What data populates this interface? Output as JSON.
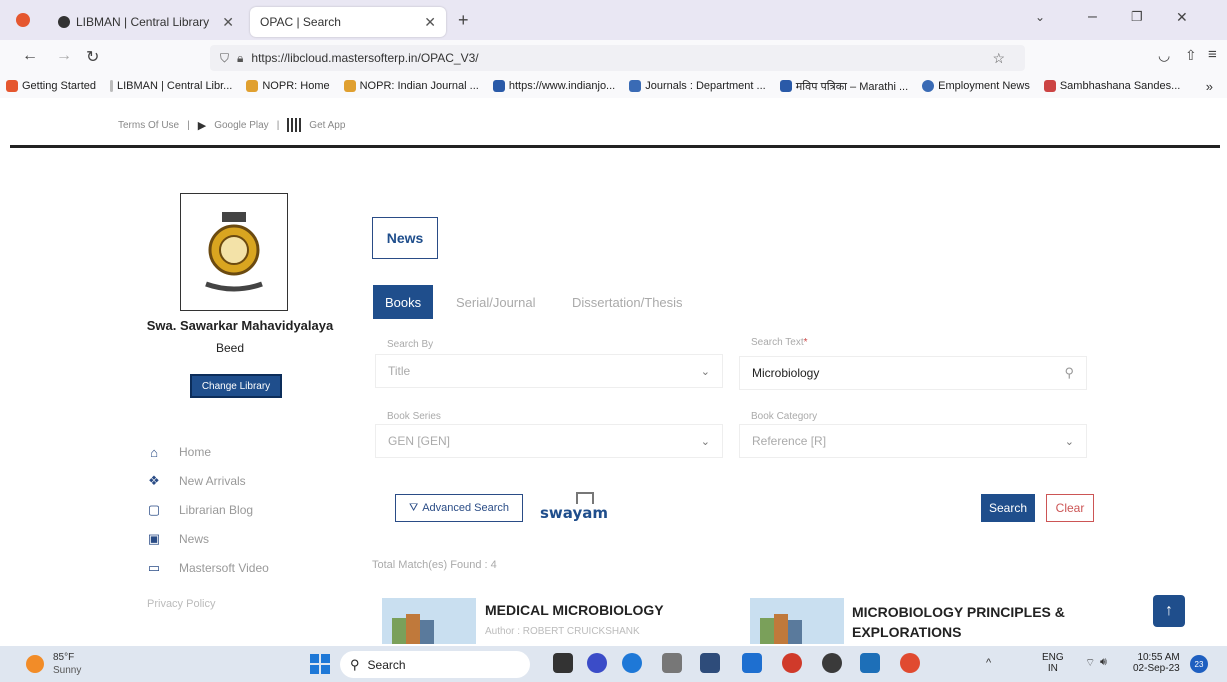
{
  "browser": {
    "tabs": [
      {
        "label": "LIBMAN | Central Library"
      },
      {
        "label": "OPAC | Search"
      }
    ],
    "new_tab": "+",
    "url": "https://libcloud.mastersofterp.in/OPAC_V3/",
    "bookmarks": [
      {
        "label": "Getting Started",
        "color": "#e5572f"
      },
      {
        "label": "LIBMAN | Central Libr...",
        "color": "#bbbbbb"
      },
      {
        "label": "NOPR: Home",
        "color": "#e0a030"
      },
      {
        "label": "NOPR: Indian Journal ...",
        "color": "#e0a030"
      },
      {
        "label": "https://www.indianjo...",
        "color": "#2a5aa8"
      },
      {
        "label": "Journals : Department ...",
        "color": "#3a6bb5"
      },
      {
        "label": "मविप पत्रिका – Marathi ...",
        "color": "#2a5aa8"
      },
      {
        "label": "Employment News",
        "color": "#3a6bb5"
      },
      {
        "label": "Sambhashana Sandes...",
        "color": "#c44"
      }
    ]
  },
  "toplinks": {
    "terms": "Terms Of Use",
    "google_play": "Google Play",
    "get_app": "Get App"
  },
  "library": {
    "college": "Swa. Sawarkar Mahavidyalaya",
    "city": "Beed",
    "change_button": "Change Library"
  },
  "sidebar": [
    {
      "label": "Home",
      "icon": "home-icon"
    },
    {
      "label": "New Arrivals",
      "icon": "new-arrivals-icon"
    },
    {
      "label": "Librarian Blog",
      "icon": "blog-icon"
    },
    {
      "label": "News",
      "icon": "news-icon"
    },
    {
      "label": "Mastersoft Video",
      "icon": "video-icon"
    }
  ],
  "privacy": "Privacy Policy",
  "news": "News",
  "search_tabs": [
    "Books",
    "Serial/Journal",
    "Dissertation/Thesis"
  ],
  "form": {
    "search_by_label": "Search By",
    "search_by_value": "Title",
    "search_text_label": "Search Text",
    "search_text_value": "Microbiology",
    "book_series_label": "Book Series",
    "book_series_value": "GEN [GEN]",
    "book_category_label": "Book Category",
    "book_category_value": "Reference [R]"
  },
  "buttons": {
    "advanced": "Advanced Search",
    "search": "Search",
    "clear": "Clear"
  },
  "swayam": "swayam",
  "results": {
    "total": "Total Match(es) Found : 4",
    "books": [
      {
        "title": "MEDICAL MICROBIOLOGY",
        "author": "Author : ROBERT CRUICKSHANK"
      },
      {
        "title": "MICROBIOLOGY PRINCIPLES & EXPLORATIONS",
        "author": ""
      }
    ]
  },
  "taskbar": {
    "weather_temp": "85°F",
    "weather_desc": "Sunny",
    "search": "Search",
    "lang": "ENG",
    "region": "IN",
    "time": "10:55 AM",
    "date": "02-Sep-23",
    "badge": "23"
  }
}
